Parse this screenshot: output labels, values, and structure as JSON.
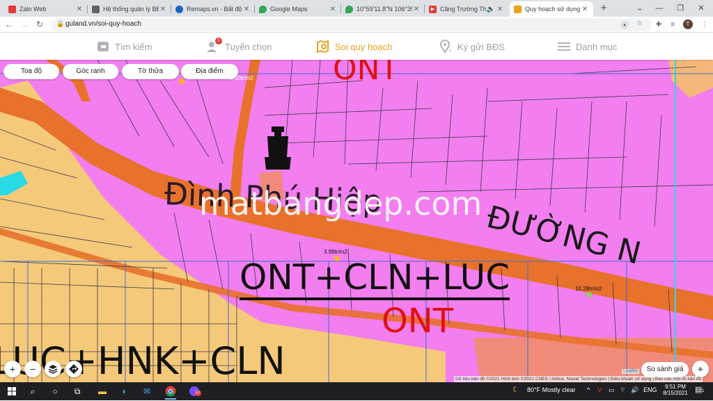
{
  "browser": {
    "tabs": [
      {
        "title": "Zalo Web",
        "fav_color": "#e53935"
      },
      {
        "title": "Hệ thống quản lý BĐS",
        "fav_color": "#5f6368"
      },
      {
        "title": "Remaps.vn - Bất động",
        "fav_color": "#1565c0"
      },
      {
        "title": "Google Maps",
        "fav_color": "#34a853"
      },
      {
        "title": "10°59'11.8\"N 106°35'1",
        "fav_color": "#34a853"
      },
      {
        "title": "Căng Trường Thái",
        "fav_color": "#e53935"
      },
      {
        "title": "Quy hoạch sử dụng đ",
        "fav_color": "#e8a21a"
      }
    ],
    "url": "guland.vn/soi-quy-hoach",
    "profile_initial": "T"
  },
  "sitenav": {
    "items": [
      {
        "label": "Tìm kiếm",
        "icon": "search-g-icon"
      },
      {
        "label": "Tuyển chọn",
        "icon": "users-icon",
        "badge": "0"
      },
      {
        "label": "Soi quy hoạch",
        "icon": "map-search-icon",
        "active": true
      },
      {
        "label": "Ký gửi BĐS",
        "icon": "pin-plus-icon"
      },
      {
        "label": "Danh mục",
        "icon": "menu-icon"
      }
    ]
  },
  "map": {
    "chips": [
      "Toạ độ",
      "Góc ranh",
      "Tờ thửa",
      "Địa điểm"
    ],
    "labels": {
      "ont_top": "ONT",
      "place": "Đình Phú Hiệp",
      "road": "ĐƯỜNG N",
      "zone_main": "ONT+CLN+LUC",
      "ont_bottom": "ONT",
      "zone_bottom": "LUC+HNK+CLN",
      "watermark": "matbangdep.com"
    },
    "prices": [
      "3.99tr/m2",
      "10.28tr/m2",
      "5.90tr/m2"
    ],
    "compare_button": "So sánh giá",
    "leaflet": "Leaflet",
    "attribution": "Dữ liệu bản đồ ©2021 Hình ảnh ©2021 CNES / Airbus, Maxar Technologies | Điều khoản sử dụng | Báo cáo một lỗi bản đồ",
    "colors": {
      "ont": "#f27ef0",
      "luc": "#f5c97a",
      "road": "#e8712b",
      "plot_line": "#3a3a4a",
      "cyan": "#28d9e6"
    }
  },
  "taskbar": {
    "weather": "80°F  Mostly clear",
    "lang": "ENG",
    "time": "9:51 PM",
    "date": "8/15/2021",
    "notif_count": "1",
    "chat_badge": "57"
  }
}
